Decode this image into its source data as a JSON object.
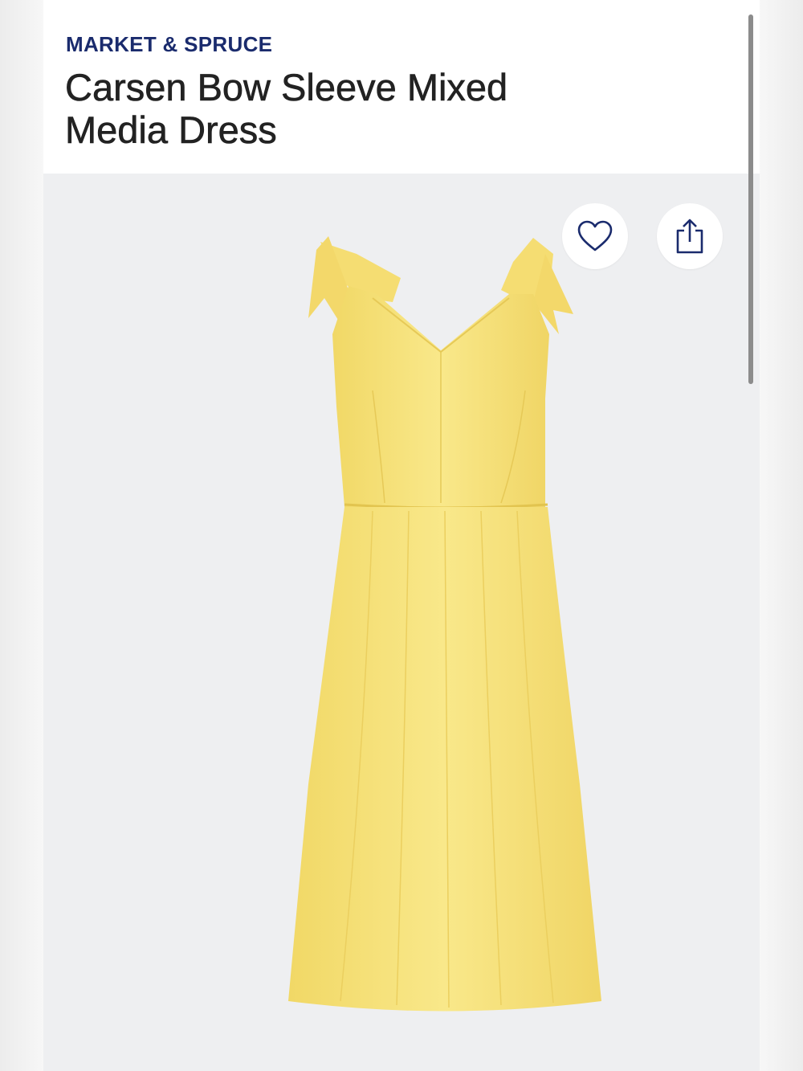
{
  "product": {
    "brand": "MARKET & SPRUCE",
    "title": "Carsen Bow Sleeve Mixed Media Dress"
  },
  "gallery": {
    "favorite_icon": "heart-icon",
    "share_icon": "share-icon",
    "image_subject": "yellow-bow-sleeve-dress"
  },
  "colors": {
    "brand_text": "#1a2b6d",
    "dress": "#f7e27a",
    "gallery_bg": "#eeeff1",
    "icon_stroke": "#1a2b6d"
  }
}
